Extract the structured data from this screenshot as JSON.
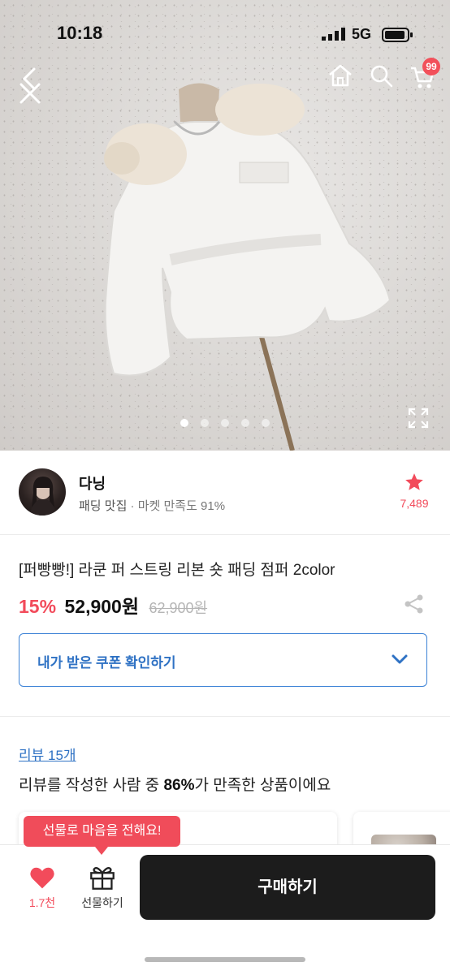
{
  "status_bar": {
    "time": "10:18",
    "network": "5G"
  },
  "header": {
    "cart_count": "99"
  },
  "gallery": {
    "image_count": 5,
    "active_index": 0
  },
  "seller": {
    "name": "다닝",
    "category": "패딩 맛집",
    "satisfaction": "· 마켓 만족도 91%",
    "favorite_count": "7,489"
  },
  "product": {
    "title": "[퍼빵빵!] 라쿤 퍼 스트링 리본 숏 패딩 점퍼 2color",
    "discount": "15%",
    "price": "52,900원",
    "original_price": "62,900원"
  },
  "coupon": {
    "label": "내가 받은 쿠폰 확인하기"
  },
  "reviews": {
    "link": "리뷰 15개",
    "summary_prefix": "리뷰를 작성한 사람 중 ",
    "summary_highlight": "86%",
    "summary_suffix": "가 만족한 상품이에요"
  },
  "bottom_bar": {
    "tooltip": "선물로 마음을 전해요!",
    "like_count": "1.7천",
    "gift_label": "선물하기",
    "buy_label": "구매하기"
  },
  "colors": {
    "accent_red": "#f24b5b",
    "link_blue": "#2f72c4",
    "buy_button": "#1c1c1c"
  }
}
